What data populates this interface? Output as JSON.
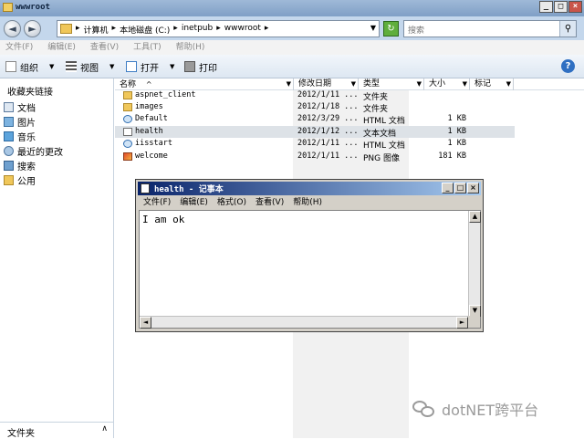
{
  "window": {
    "title": "wwwroot",
    "buttons": [
      "_",
      "□",
      "×"
    ]
  },
  "address": {
    "back": "◄",
    "forward": "►",
    "crumbs": [
      "▸",
      "计算机",
      "▸",
      "本地磁盘 (C:)",
      "▸",
      "inetpub",
      "▸",
      "wwwroot",
      "▸"
    ],
    "dropdown": "▼",
    "refresh": "↻",
    "search_placeholder": "搜索",
    "search_icon": "⚲"
  },
  "menu": [
    "文件(F)",
    "编辑(E)",
    "查看(V)",
    "工具(T)",
    "帮助(H)"
  ],
  "toolbar": {
    "organize": "组织",
    "view": "视图",
    "open": "打开",
    "print": "打印",
    "arrow": "▼",
    "help": "?"
  },
  "nav": {
    "header": "收藏夹链接",
    "items": [
      {
        "label": "文档",
        "icon": "document-icon"
      },
      {
        "label": "图片",
        "icon": "pictures-icon"
      },
      {
        "label": "音乐",
        "icon": "music-icon"
      },
      {
        "label": "最近的更改",
        "icon": "recent-icon"
      },
      {
        "label": "搜索",
        "icon": "search-folder-icon"
      },
      {
        "label": "公用",
        "icon": "public-folder-icon"
      }
    ],
    "bottom_label": "文件夹",
    "bottom_chevron": "∧"
  },
  "columns": [
    {
      "label": "名称",
      "sort": "^"
    },
    {
      "label": "修改日期"
    },
    {
      "label": "类型"
    },
    {
      "label": "大小"
    },
    {
      "label": "标记"
    }
  ],
  "files": [
    {
      "name": "aspnet_client",
      "date": "2012/1/11 ...",
      "type": "文件夹",
      "size": "",
      "icon": "folder-icon"
    },
    {
      "name": "images",
      "date": "2012/1/18 ...",
      "type": "文件夹",
      "size": "",
      "icon": "folder-icon"
    },
    {
      "name": "Default",
      "date": "2012/3/29 ...",
      "type": "HTML 文档",
      "size": "1 KB",
      "icon": "html-icon"
    },
    {
      "name": "health",
      "date": "2012/1/12 ...",
      "type": "文本文档",
      "size": "1 KB",
      "icon": "text-file-icon"
    },
    {
      "name": "iisstart",
      "date": "2012/1/11 ...",
      "type": "HTML 文档",
      "size": "1 KB",
      "icon": "html-icon"
    },
    {
      "name": "welcome",
      "date": "2012/1/11 ...",
      "type": "PNG 图像",
      "size": "181 KB",
      "icon": "png-icon"
    }
  ],
  "notepad": {
    "title": "health - 记事本",
    "buttons": [
      "_",
      "□",
      "×"
    ],
    "menu": [
      "文件(F)",
      "编辑(E)",
      "格式(O)",
      "查看(V)",
      "帮助(H)"
    ],
    "content": "I am ok",
    "scroll_up": "▲",
    "scroll_down": "▼",
    "scroll_left": "◄",
    "scroll_right": "►"
  },
  "watermark": "dotNET跨平台"
}
